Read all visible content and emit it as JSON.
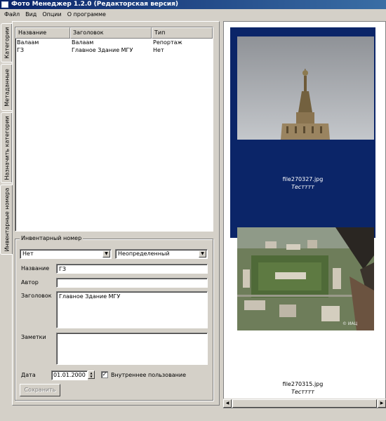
{
  "window": {
    "title": "Фото Менеджер 1.2.0  (Редакторская версия)"
  },
  "menu": [
    "Файл",
    "Вид",
    "Опции",
    "О программе"
  ],
  "tabs": [
    "Инвентарные номера",
    "Назначить категории",
    "Метаданные",
    "Категории"
  ],
  "active_tab": "Инвентарные номера",
  "list": {
    "columns": [
      "Название",
      "Заголовок",
      "Тип"
    ],
    "rows": [
      [
        "Валаам",
        "Валаам",
        "Репортаж"
      ],
      [
        "ГЗ",
        "Главное Здание МГУ",
        "Нет"
      ]
    ]
  },
  "form": {
    "group_title": "Инвентарный номер",
    "combo1": "Нет",
    "combo2": "Неопределенный",
    "name_label": "Название",
    "name_value": "ГЗ",
    "author_label": "Автор",
    "author_value": "",
    "heading_label": "Заголовок",
    "heading_value": "Главное Здание МГУ",
    "notes_label": "Заметки",
    "notes_value": "",
    "date_label": "Дата",
    "date_value": "01.01.2000",
    "internal_use_label": "Внутреннее пользование",
    "internal_use_checked": true,
    "save_label": "Сохранить"
  },
  "photos": [
    {
      "file": "file270327.jpg",
      "caption": "Тестттт",
      "selected": true
    },
    {
      "file": "file270315.jpg",
      "caption": "Тестттт",
      "selected": false
    }
  ],
  "watermark": "© ИАЦ"
}
